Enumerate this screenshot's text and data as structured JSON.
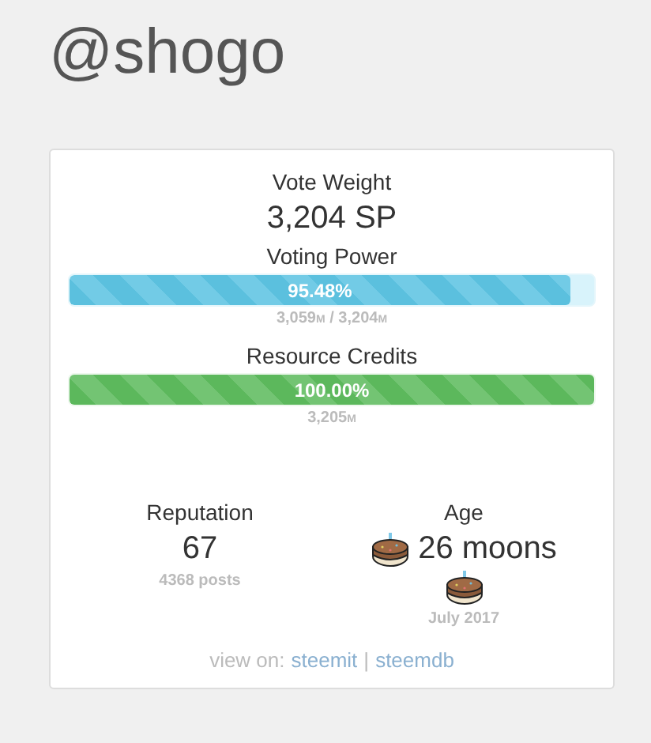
{
  "title": "@shogo",
  "vote_weight": {
    "label": "Vote Weight",
    "value": "3,204 SP"
  },
  "meters": [
    {
      "kind": "blue",
      "label": "Voting Power",
      "level": 0.9548,
      "reading": "95.48%",
      "amounts": [
        {
          "amount": "3,059",
          "unit": "M"
        },
        {
          "amount": "3,204",
          "unit": "M"
        }
      ],
      "separator": "/"
    },
    {
      "kind": "green",
      "label": "Resource Credits",
      "level": 1.0,
      "reading": "100.00%",
      "amounts": [
        {
          "amount": "3,205",
          "unit": "M"
        }
      ]
    }
  ],
  "reputation": {
    "label": "Reputation",
    "value": "67",
    "note": "4368 posts"
  },
  "age": {
    "label": "Age",
    "value": "26 moons",
    "note": "July 2017"
  },
  "footer": {
    "prefix": "view on:",
    "links": [
      "steemit",
      "steemdb"
    ],
    "separator": "|"
  }
}
